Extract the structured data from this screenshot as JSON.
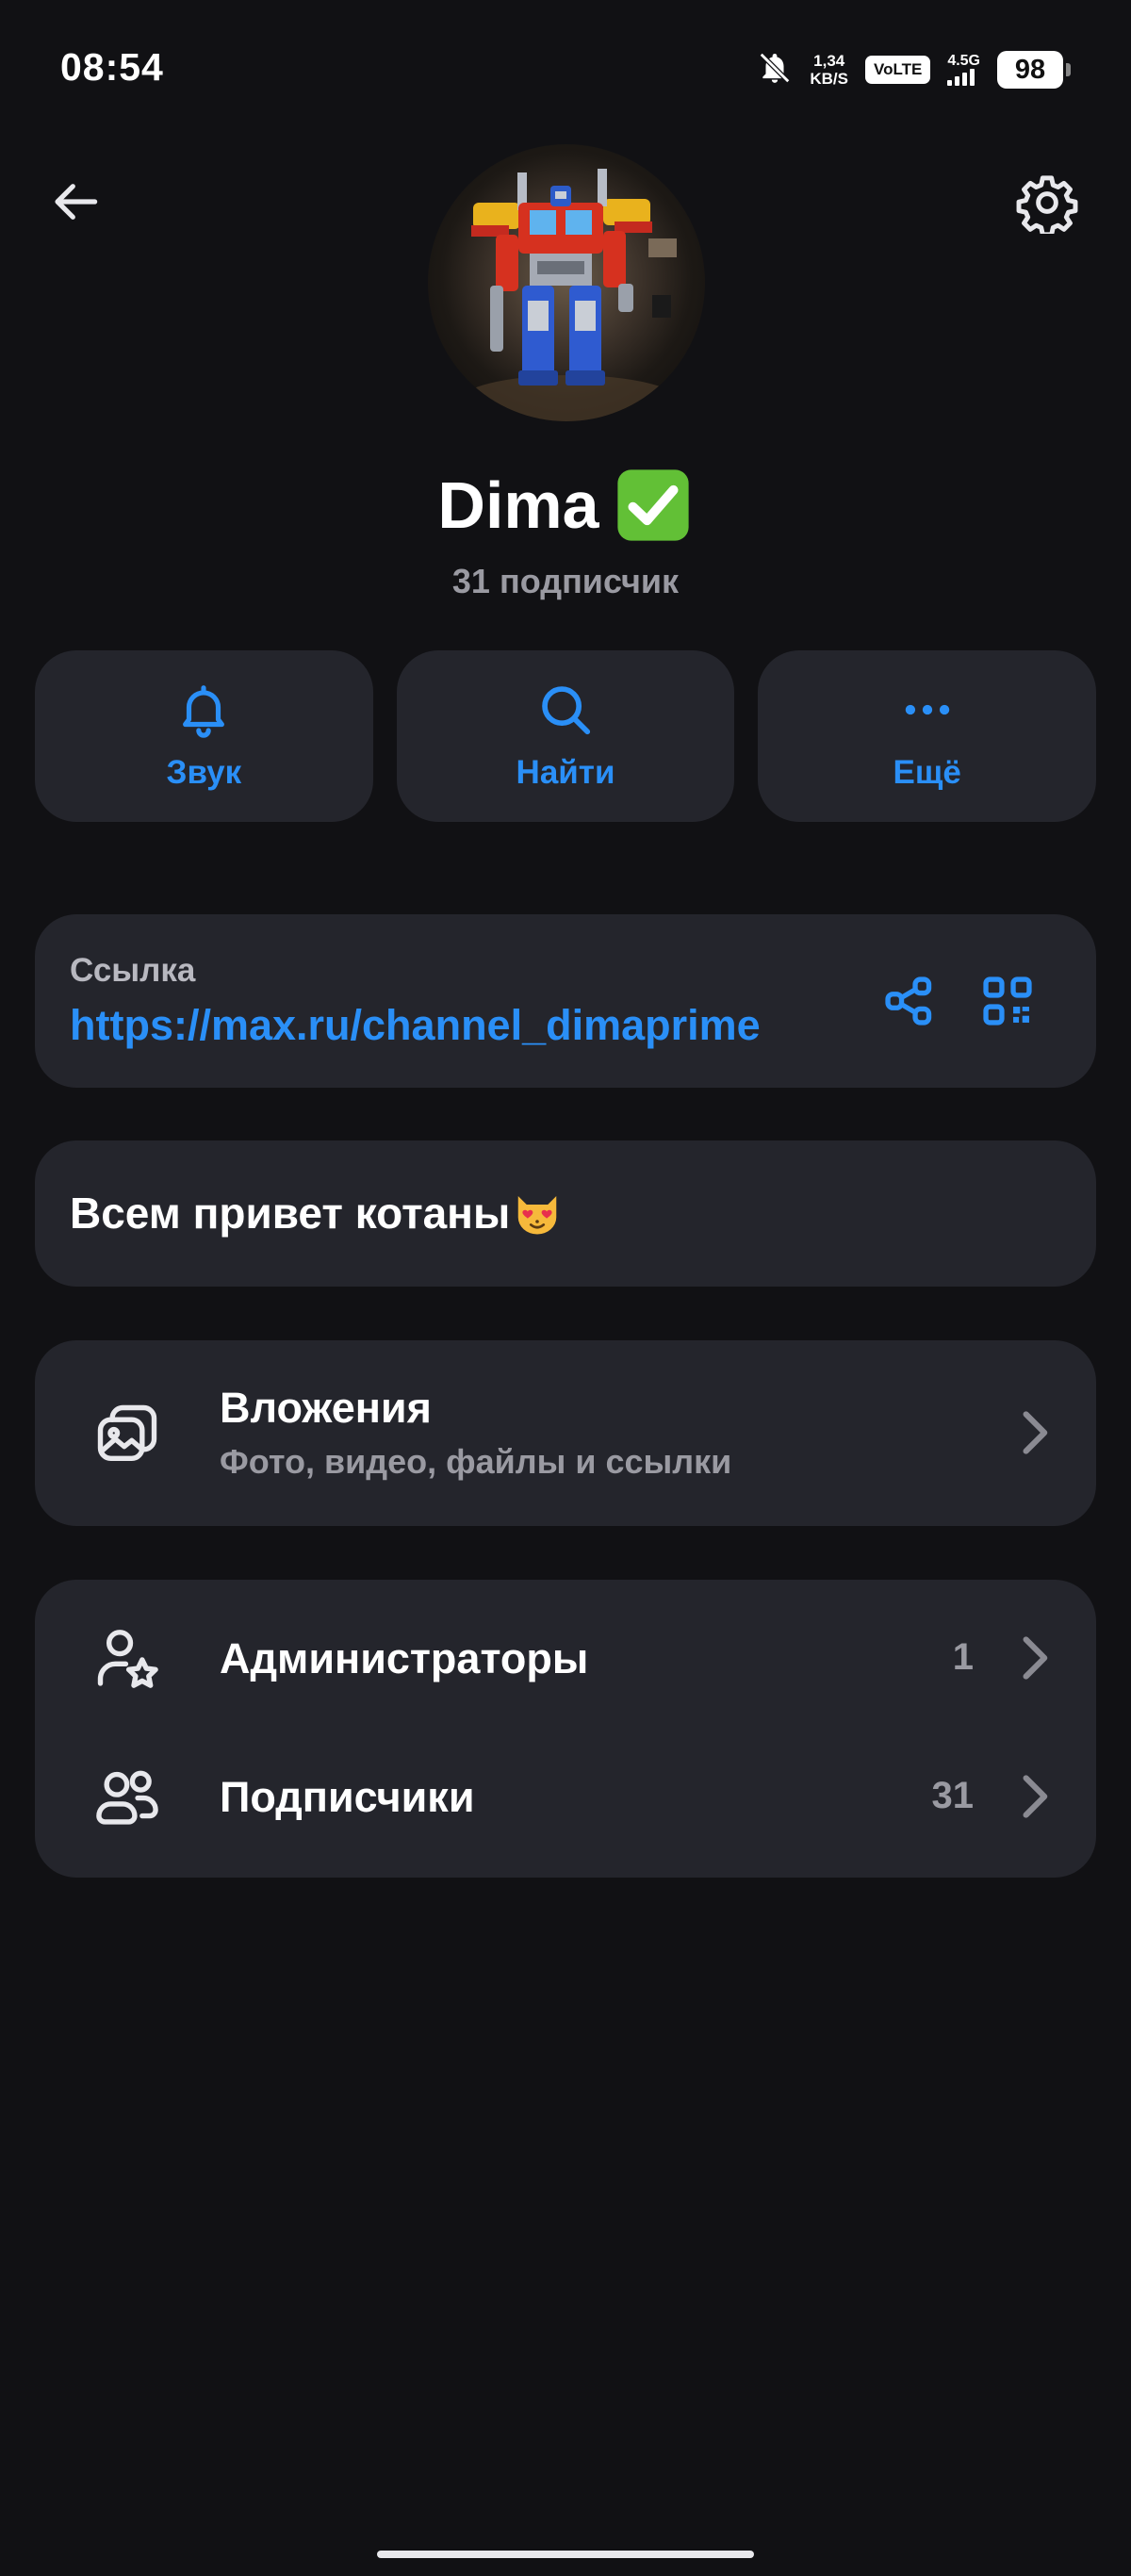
{
  "status_bar": {
    "time": "08:54",
    "net_speed_value": "1,34",
    "net_speed_unit": "KB/S",
    "volte": "VoLTE",
    "network": "4.5G",
    "battery": "98"
  },
  "profile": {
    "name": "Dima",
    "subscribers_text": "31 подписчик"
  },
  "actions": [
    {
      "label": "Звук",
      "icon": "bell-icon"
    },
    {
      "label": "Найти",
      "icon": "search-icon"
    },
    {
      "label": "Ещё",
      "icon": "more-dots-icon"
    }
  ],
  "link": {
    "title": "Ссылка",
    "url": "https://max.ru/channel_dimaprime"
  },
  "description": {
    "text": "Всем привет котаны"
  },
  "attachments": {
    "title": "Вложения",
    "subtitle": "Фото, видео, файлы и ссылки"
  },
  "members": [
    {
      "label": "Администраторы",
      "count": "1",
      "icon": "admin-star-icon"
    },
    {
      "label": "Подписчики",
      "count": "31",
      "icon": "users-icon"
    }
  ],
  "colors": {
    "background": "#111114",
    "card": "#24252c",
    "accent": "#2a8ff7",
    "muted": "#9a9aa2"
  }
}
